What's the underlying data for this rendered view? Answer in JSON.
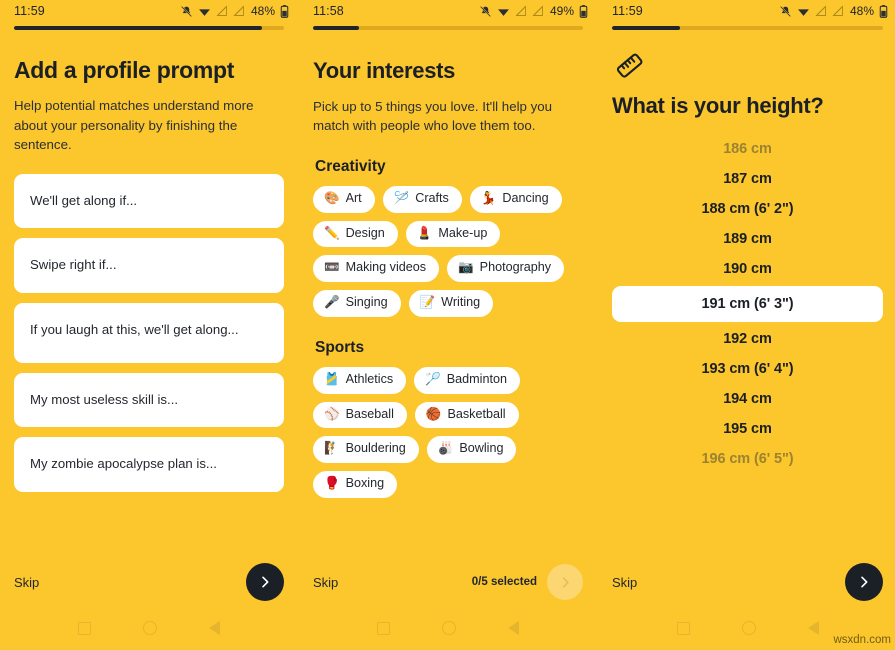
{
  "theme": {
    "background": "#FCC62D",
    "ink": "#1B1F26",
    "card": "#FFFFFF",
    "track": "#E0A81F",
    "dim_text": "#9B8330",
    "disabled_fab": "#FCD670"
  },
  "watermark": "wsxdn.com",
  "screens": [
    {
      "id": "profile-prompt",
      "status": {
        "time": "11:59",
        "battery": "48%"
      },
      "progress_percent": 92,
      "title": "Add a profile prompt",
      "subtitle": "Help potential matches understand more about your personality by finishing the sentence.",
      "cards": [
        "We'll get along if...",
        "Swipe right if...",
        "If you laugh at this, we'll get along...",
        "My most useless skill is...",
        "My zombie apocalypse plan is..."
      ],
      "bottom": {
        "skip": "Skip",
        "next_icon": "chevron-right-icon",
        "next_enabled": true
      }
    },
    {
      "id": "your-interests",
      "status": {
        "time": "11:58",
        "battery": "49%"
      },
      "progress_percent": 17,
      "title": "Your interests",
      "subtitle": "Pick up to 5 things you love. It'll help you match with people who love them too.",
      "sections": [
        {
          "heading": "Creativity",
          "chips": [
            {
              "emoji": "🎨",
              "label": "Art"
            },
            {
              "emoji": "🪡",
              "label": "Crafts"
            },
            {
              "emoji": "💃",
              "label": "Dancing"
            },
            {
              "emoji": "✏️",
              "label": "Design"
            },
            {
              "emoji": "💄",
              "label": "Make-up"
            },
            {
              "emoji": "📼",
              "label": "Making videos"
            },
            {
              "emoji": "📷",
              "label": "Photography"
            },
            {
              "emoji": "🎤",
              "label": "Singing"
            },
            {
              "emoji": "📝",
              "label": "Writing"
            }
          ]
        },
        {
          "heading": "Sports",
          "chips": [
            {
              "emoji": "🎽",
              "label": "Athletics"
            },
            {
              "emoji": "🏸",
              "label": "Badminton"
            },
            {
              "emoji": "⚾",
              "label": "Baseball"
            },
            {
              "emoji": "🏀",
              "label": "Basketball"
            },
            {
              "emoji": "🧗",
              "label": "Bouldering"
            },
            {
              "emoji": "🎳",
              "label": "Bowling"
            },
            {
              "emoji": "🥊",
              "label": "Boxing"
            }
          ]
        }
      ],
      "bottom": {
        "skip": "Skip",
        "selected_count": "0/5 selected",
        "next_icon": "chevron-right-icon",
        "next_enabled": false
      }
    },
    {
      "id": "height",
      "status": {
        "time": "11:59",
        "battery": "48%"
      },
      "progress_percent": 25,
      "icon": "ruler-icon",
      "title": "What is your height?",
      "heights": [
        {
          "label": "186 cm",
          "state": "dim"
        },
        {
          "label": "187 cm",
          "state": "normal"
        },
        {
          "label": "188 cm (6' 2\")",
          "state": "normal"
        },
        {
          "label": "189 cm",
          "state": "normal"
        },
        {
          "label": "190 cm",
          "state": "normal"
        },
        {
          "label": "191 cm (6' 3\")",
          "state": "selected"
        },
        {
          "label": "192 cm",
          "state": "normal"
        },
        {
          "label": "193 cm (6' 4\")",
          "state": "normal"
        },
        {
          "label": "194 cm",
          "state": "normal"
        },
        {
          "label": "195 cm",
          "state": "normal"
        },
        {
          "label": "196 cm (6' 5\")",
          "state": "dim"
        }
      ],
      "bottom": {
        "skip": "Skip",
        "next_icon": "chevron-right-icon",
        "next_enabled": true
      }
    }
  ],
  "navbar": {
    "recent": "square-icon",
    "home": "circle-icon",
    "back": "triangle-back-icon"
  }
}
